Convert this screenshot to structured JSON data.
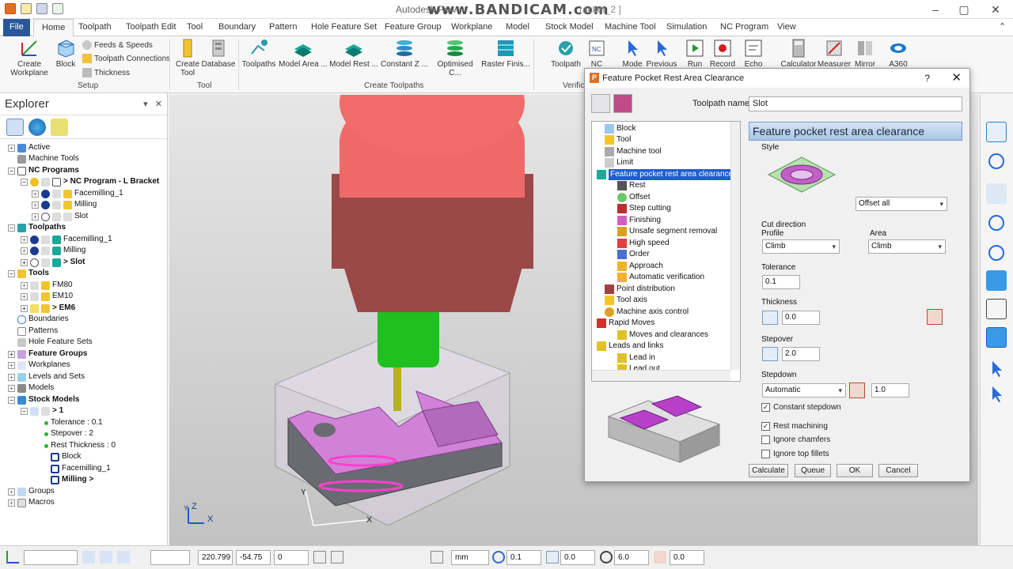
{
  "window": {
    "title": "Autodesk Power",
    "title_suffix": "racket_2 ]",
    "watermark": "www.BANDICAM.com"
  },
  "menu_tabs": [
    "File",
    "Home",
    "Toolpath",
    "Toolpath Edit",
    "Tool",
    "Boundary",
    "Pattern",
    "Hole Feature Set",
    "Feature Group",
    "Workplane",
    "Model",
    "Stock Model",
    "Machine Tool",
    "Simulation",
    "NC Program",
    "View"
  ],
  "ribbon": {
    "setup": {
      "create_workplane": "Create Workplane",
      "block": "Block",
      "feeds_speeds": "Feeds & Speeds",
      "toolpath_connections": "Toolpath Connections",
      "thickness": "Thickness",
      "label": "Setup"
    },
    "tool": {
      "create_tool": "Create Tool",
      "database": "Database",
      "label": "Tool"
    },
    "create_toolpaths": {
      "toolpaths": "Toolpaths",
      "items": [
        "Model Area ...",
        "Model Rest ...",
        "Constant Z ...",
        "Optimised C...",
        "Raster Finis..."
      ],
      "label": "Create Toolpaths"
    },
    "verify": {
      "toolpath": "Toolpath",
      "nc": "NC",
      "label": "Verific"
    },
    "others": [
      "Mode",
      "Previous",
      "Run",
      "Record",
      "Echo",
      "Calculator",
      "Measurer",
      "Mirror",
      "A360"
    ]
  },
  "explorer": {
    "title": "Explorer",
    "items": [
      {
        "label": "Active",
        "bold": false
      },
      {
        "label": "Machine Tools",
        "bold": false
      },
      {
        "label": "NC Programs",
        "bold": true
      },
      {
        "label": "> NC Program - L Bracket",
        "bold": true
      },
      {
        "label": "Facemilling_1",
        "bold": false
      },
      {
        "label": "Milling",
        "bold": false
      },
      {
        "label": "Slot",
        "bold": false
      },
      {
        "label": "Toolpaths",
        "bold": true
      },
      {
        "label": "Facemilling_1",
        "bold": false
      },
      {
        "label": "Milling",
        "bold": false
      },
      {
        "label": "> Slot",
        "bold": true
      },
      {
        "label": "Tools",
        "bold": true
      },
      {
        "label": "FM80",
        "bold": false
      },
      {
        "label": "EM10",
        "bold": false
      },
      {
        "label": "> EM6",
        "bold": true
      },
      {
        "label": "Boundaries",
        "bold": false
      },
      {
        "label": "Patterns",
        "bold": false
      },
      {
        "label": "Hole Feature Sets",
        "bold": false
      },
      {
        "label": "Feature Groups",
        "bold": true
      },
      {
        "label": "Workplanes",
        "bold": false
      },
      {
        "label": "Levels and Sets",
        "bold": false
      },
      {
        "label": "Models",
        "bold": false
      },
      {
        "label": "Stock Models",
        "bold": true
      },
      {
        "label": "> 1",
        "bold": true
      },
      {
        "label": "Tolerance : 0.1",
        "bold": false
      },
      {
        "label": "Stepover : 2",
        "bold": false
      },
      {
        "label": "Rest Thickness : 0",
        "bold": false
      },
      {
        "label": "Block",
        "bold": false
      },
      {
        "label": "Facemilling_1",
        "bold": false
      },
      {
        "label": "Milling >",
        "bold": true
      },
      {
        "label": "Groups",
        "bold": false
      },
      {
        "label": "Macros",
        "bold": false
      }
    ]
  },
  "viewport": {
    "axes": {
      "x": "X",
      "y": "Y",
      "z": "Z"
    }
  },
  "dialog": {
    "title": "Feature Pocket Rest Area Clearance",
    "help": "?",
    "toolpath_name_label": "Toolpath name",
    "toolpath_name": "Slot",
    "tree": [
      "Block",
      "Tool",
      "Machine tool",
      "Limit",
      "Feature pocket rest area clearance",
      "Rest",
      "Offset",
      "Step cutting",
      "Finishing",
      "Unsafe segment removal",
      "High speed",
      "Order",
      "Approach",
      "Automatic verification",
      "Point distribution",
      "Tool axis",
      "Machine axis control",
      "Rapid Moves",
      "Moves and clearances",
      "Leads and links",
      "Lead in",
      "Lead out"
    ],
    "section_title": "Feature pocket rest area clearance",
    "style_label": "Style",
    "style_value": "Offset all",
    "cut_direction_label": "Cut direction",
    "profile_label": "Profile",
    "profile_value": "Climb",
    "area_label": "Area",
    "area_value": "Climb",
    "tolerance_label": "Tolerance",
    "tolerance_value": "0.1",
    "thickness_label": "Thickness",
    "thickness_value": "0.0",
    "stepover_label": "Stepover",
    "stepover_value": "2.0",
    "stepdown_label": "Stepdown",
    "stepdown_mode": "Automatic",
    "stepdown_value": "1.0",
    "constant_stepdown": "Constant stepdown",
    "rest_machining": "Rest machining",
    "ignore_chamfers": "Ignore chamfers",
    "ignore_top_fillets": "Ignore top fillets",
    "buttons": {
      "calculate": "Calculate",
      "queue": "Queue",
      "ok": "OK",
      "cancel": "Cancel"
    }
  },
  "statusbar": {
    "x": "220.799",
    "y": "-54.75",
    "z": "0",
    "units": "mm",
    "tol": "0.1",
    "thick": "0.0",
    "dia": "6.0",
    "extra": "0.0"
  }
}
